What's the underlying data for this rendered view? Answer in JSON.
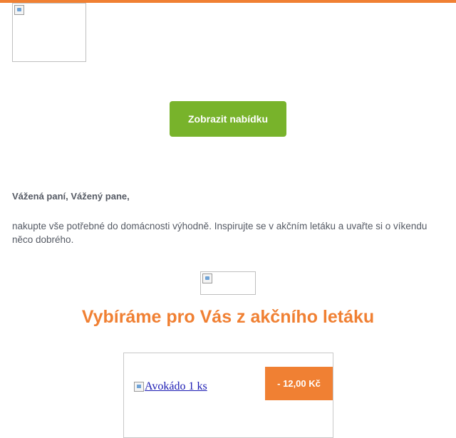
{
  "header": {
    "logo_alt": ""
  },
  "cta": {
    "label": "Zobrazit nabídku"
  },
  "message": {
    "greeting": "Vážená paní, Vážený pane,",
    "intro": "nakupte vše potřebné do domácnosti výhodně. Inspirujte se v akčním letáku a uvařte si o víkendu něco dobrého."
  },
  "section": {
    "heading": "Vybíráme pro Vás z akčního letáku"
  },
  "product": {
    "name": "Avokádo 1 ks",
    "price_badge": "- 12,00 Kč"
  },
  "colors": {
    "accent": "#f08033",
    "cta": "#78b32b"
  }
}
